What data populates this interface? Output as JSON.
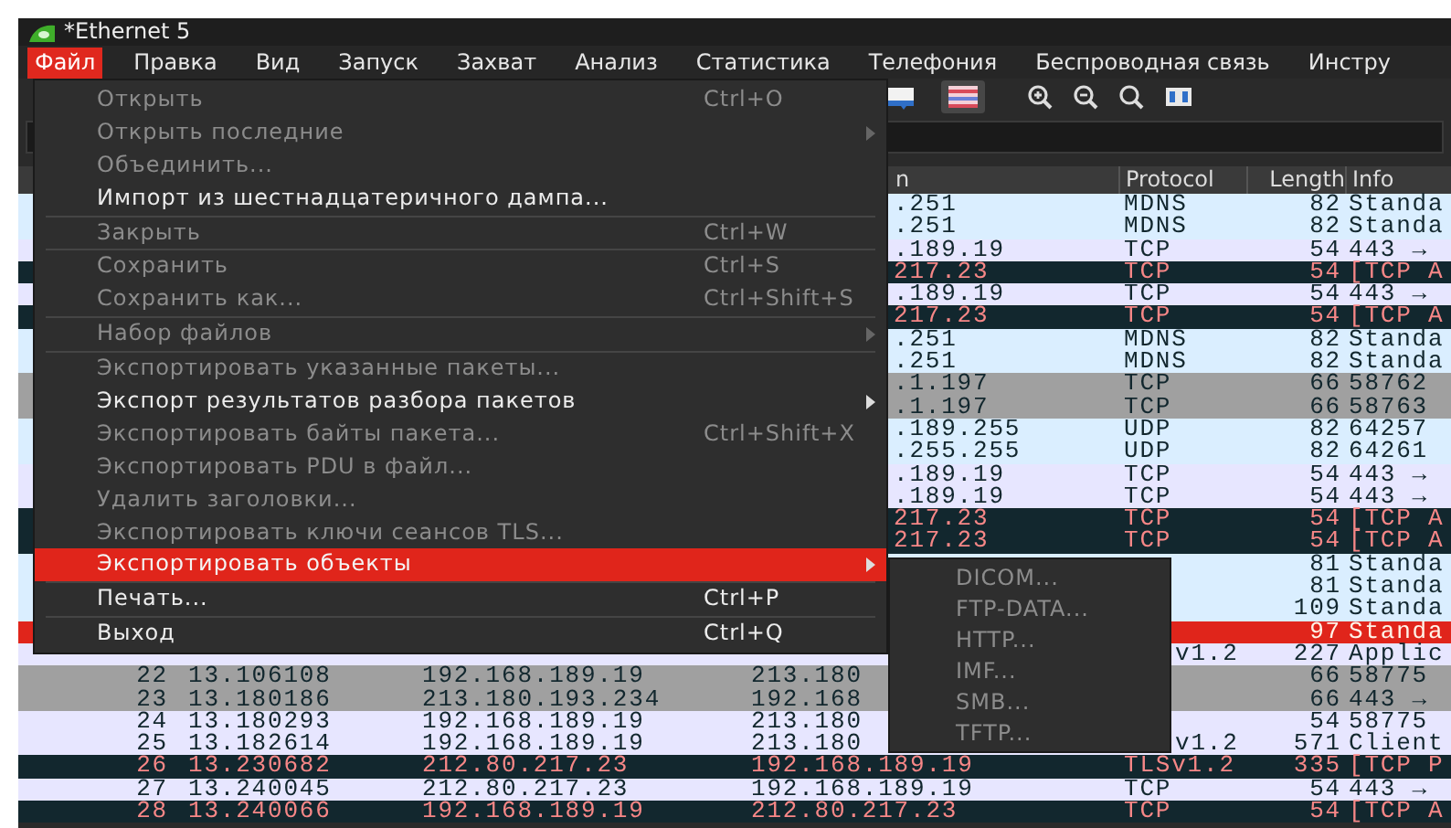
{
  "window": {
    "title": "*Ethernet 5"
  },
  "menu_bar": [
    {
      "label": "Файл",
      "selected": true
    },
    {
      "label": "Правка",
      "selected": false
    },
    {
      "label": "Вид",
      "selected": false
    },
    {
      "label": "Запуск",
      "selected": false
    },
    {
      "label": "Захват",
      "selected": false
    },
    {
      "label": "Анализ",
      "selected": false
    },
    {
      "label": "Статистика",
      "selected": false
    },
    {
      "label": "Телефония",
      "selected": false
    },
    {
      "label": "Беспроводная связь",
      "selected": false
    },
    {
      "label": "Инстру",
      "selected": false
    }
  ],
  "packet_list": {
    "columns": [
      {
        "label": "n"
      },
      {
        "label": "Protocol"
      },
      {
        "label": "Length"
      },
      {
        "label": "Info"
      }
    ],
    "rows": [
      {
        "column_4": ".251",
        "protocol": "MDNS",
        "length": "82",
        "info": "Standa",
        "color": "#daeeff",
        "selected": false
      },
      {
        "column_4": ".251",
        "protocol": "MDNS",
        "length": "82",
        "info": "Standa",
        "color": "#daeeff",
        "selected": false
      },
      {
        "column_4": ".189.19",
        "protocol": "TCP",
        "length": "54",
        "info": "443 →",
        "color": "#e7e6ff",
        "selected": false
      },
      {
        "column_4": "217.23",
        "protocol": "TCP",
        "length": "54",
        "info": "[TCP A",
        "color": "#12272e",
        "selected": false
      },
      {
        "column_4": ".189.19",
        "protocol": "TCP",
        "length": "54",
        "info": "443 →",
        "color": "#e7e6ff",
        "selected": false
      },
      {
        "column_4": "217.23",
        "protocol": "TCP",
        "length": "54",
        "info": "[TCP A",
        "color": "#12272e",
        "selected": false
      },
      {
        "column_4": ".251",
        "protocol": "MDNS",
        "length": "82",
        "info": "Standa",
        "color": "#daeeff",
        "selected": false
      },
      {
        "column_4": ".251",
        "protocol": "MDNS",
        "length": "82",
        "info": "Standa",
        "color": "#daeeff",
        "selected": false
      },
      {
        "column_4": ".1.197",
        "protocol": "TCP",
        "length": "66",
        "info": "58762",
        "color": "#a0a0a0",
        "selected": false
      },
      {
        "column_4": ".1.197",
        "protocol": "TCP",
        "length": "66",
        "info": "58763",
        "color": "#a0a0a0",
        "selected": false
      },
      {
        "column_4": ".189.255",
        "protocol": "UDP",
        "length": "82",
        "info": "64257",
        "color": "#daeeff",
        "selected": false
      },
      {
        "column_4": ".255.255",
        "protocol": "UDP",
        "length": "82",
        "info": "64261",
        "color": "#daeeff",
        "selected": false
      },
      {
        "column_4": ".189.19",
        "protocol": "TCP",
        "length": "54",
        "info": "443 →",
        "color": "#e7e6ff",
        "selected": false
      },
      {
        "column_4": ".189.19",
        "protocol": "TCP",
        "length": "54",
        "info": "443 →",
        "color": "#e7e6ff",
        "selected": false
      },
      {
        "column_4": "217.23",
        "protocol": "TCP",
        "length": "54",
        "info": "[TCP A",
        "color": "#12272e",
        "selected": false
      },
      {
        "column_4": "217.23",
        "protocol": "TCP",
        "length": "54",
        "info": "[TCP A",
        "color": "#12272e",
        "selected": false
      },
      {
        "length": "81",
        "info": "Standa",
        "color": "#daeeff",
        "selected": false
      },
      {
        "length": "81",
        "info": "Standa",
        "color": "#daeeff",
        "selected": false
      },
      {
        "length": "109",
        "info": "Standa",
        "color": "#daeeff",
        "selected": false
      },
      {
        "length": "97",
        "info": "Standa",
        "selected": true
      },
      {
        "protocol": "v1.2",
        "length": "227",
        "info": "Applic",
        "color": "#e7e6ff",
        "selected": false
      },
      {
        "column_1": "22",
        "column_2": "13.106108",
        "column_3": "192.168.189.19",
        "column_4": "213.180",
        "length": "66",
        "info": "58775",
        "color": "#a0a0a0",
        "selected": false
      },
      {
        "column_1": "23",
        "column_2": "13.180186",
        "column_3": "213.180.193.234",
        "column_4": "192.168",
        "length": "66",
        "info": "443 →",
        "color": "#a0a0a0",
        "selected": false
      },
      {
        "column_1": "24",
        "column_2": "13.180293",
        "column_3": "192.168.189.19",
        "column_4": "213.180",
        "length": "54",
        "info": "58775",
        "color": "#e7e6ff",
        "selected": false
      },
      {
        "column_1": "25",
        "column_2": "13.182614",
        "column_3": "192.168.189.19",
        "column_4": "213.180",
        "protocol": "v1.2",
        "length": "571",
        "info": "Client",
        "color": "#e7e6ff",
        "selected": false
      },
      {
        "column_1": "26",
        "column_2": "13.230682",
        "column_3": "212.80.217.23",
        "column_4": "192.168.189.19",
        "protocol": "TLSv1.2",
        "length": "335",
        "info": "[TCP P",
        "color": "#12272e",
        "selected": false
      },
      {
        "column_1": "27",
        "column_2": "13.240045",
        "column_3": "212.80.217.23",
        "column_4": "192.168.189.19",
        "protocol": "TCP",
        "length": "54",
        "info": "443 →",
        "color": "#e7e6ff",
        "selected": false
      },
      {
        "column_1": "28",
        "column_2": "13.240066",
        "column_3": "192.168.189.19",
        "column_4": "212.80.217.23",
        "protocol": "TCP",
        "length": "54",
        "info": "[TCP A",
        "color": "#12272e",
        "selected": false
      }
    ]
  },
  "file_menu": {
    "items": [
      {
        "kind": "item",
        "label": "Открыть",
        "shortcut": "Ctrl+O",
        "disabled": true,
        "submenu": false,
        "selected": false
      },
      {
        "kind": "item",
        "label": "Открыть последние",
        "disabled": true,
        "submenu": true,
        "selected": false
      },
      {
        "kind": "item",
        "label": "Объединить...",
        "disabled": true,
        "submenu": false,
        "selected": false
      },
      {
        "kind": "item",
        "label": "Импорт из шестнадцатеричного дампа...",
        "disabled": false,
        "submenu": false,
        "selected": false
      },
      {
        "kind": "separator"
      },
      {
        "kind": "item",
        "label": "Закрыть",
        "shortcut": "Ctrl+W",
        "disabled": true,
        "submenu": false,
        "selected": false
      },
      {
        "kind": "separator"
      },
      {
        "kind": "item",
        "label": "Сохранить",
        "shortcut": "Ctrl+S",
        "disabled": true,
        "submenu": false,
        "selected": false
      },
      {
        "kind": "item",
        "label": "Сохранить как...",
        "shortcut": "Ctrl+Shift+S",
        "disabled": true,
        "submenu": false,
        "selected": false
      },
      {
        "kind": "separator"
      },
      {
        "kind": "item",
        "label": "Набор файлов",
        "disabled": true,
        "submenu": true,
        "selected": false
      },
      {
        "kind": "separator"
      },
      {
        "kind": "item",
        "label": "Экспортировать указанные пакеты...",
        "disabled": true,
        "submenu": false,
        "selected": false
      },
      {
        "kind": "item",
        "label": "Экспорт результатов разбора пакетов",
        "disabled": false,
        "submenu": true,
        "selected": false
      },
      {
        "kind": "item",
        "label": "Экспортировать байты пакета...",
        "shortcut": "Ctrl+Shift+X",
        "disabled": true,
        "submenu": false,
        "selected": false
      },
      {
        "kind": "item",
        "label": "Экспортировать PDU в файл...",
        "disabled": true,
        "submenu": false,
        "selected": false
      },
      {
        "kind": "item",
        "label": "Удалить заголовки...",
        "disabled": true,
        "submenu": false,
        "selected": false
      },
      {
        "kind": "item",
        "label": "Экспортировать ключи сеансов TLS...",
        "disabled": true,
        "submenu": false,
        "selected": false
      },
      {
        "kind": "item",
        "label": "Экспортировать объекты",
        "disabled": false,
        "submenu": true,
        "selected": true
      },
      {
        "kind": "separator"
      },
      {
        "kind": "item",
        "label": "Печать...",
        "shortcut": "Ctrl+P",
        "disabled": false,
        "submenu": false,
        "selected": false
      },
      {
        "kind": "separator"
      },
      {
        "kind": "item",
        "label": "Выход",
        "shortcut": "Ctrl+Q",
        "disabled": false,
        "submenu": false,
        "selected": false
      }
    ]
  },
  "export_objects_menu": {
    "items": [
      {
        "label": "DICOM...",
        "disabled": true
      },
      {
        "label": "FTP-DATA...",
        "disabled": true
      },
      {
        "label": "HTTP...",
        "disabled": true
      },
      {
        "label": "IMF...",
        "disabled": true
      },
      {
        "label": "SMB...",
        "disabled": true
      },
      {
        "label": "TFTP...",
        "disabled": true
      }
    ]
  }
}
